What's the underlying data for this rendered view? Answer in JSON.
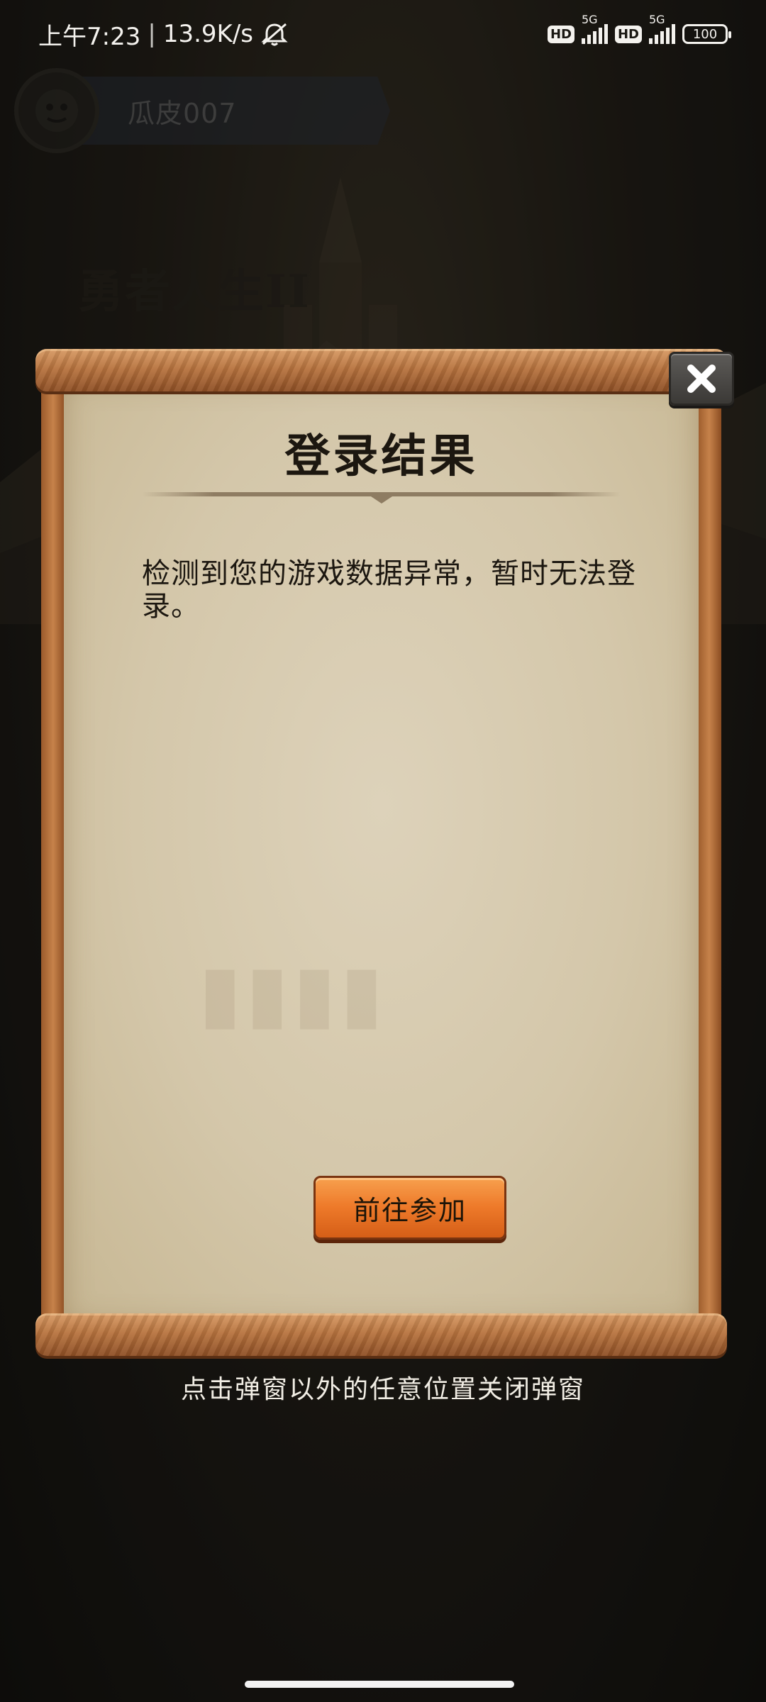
{
  "status_bar": {
    "time": "上午7:23",
    "net_speed": "13.9K/s",
    "hd_badge": "HD",
    "network": "5G",
    "battery": "100"
  },
  "background": {
    "player_name": "瓜皮007",
    "game_title": "勇者人生II"
  },
  "dialog": {
    "title": "登录结果",
    "message": "检测到您的游戏数据异常，暂时无法登录。",
    "action_button": "前往参加",
    "close_icon": "close-icon"
  },
  "hint": "点击弹窗以外的任意位置关闭弹窗",
  "colors": {
    "paper": "#d8ccb2",
    "scroll_wood": "#b8743f",
    "action_button": "#ee7a2a",
    "close_button": "#4a4845"
  }
}
